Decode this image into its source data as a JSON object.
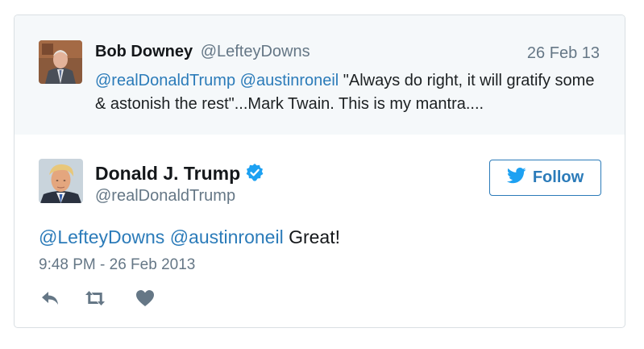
{
  "parent_tweet": {
    "author_name": "Bob Downey",
    "author_handle": "@LefteyDowns",
    "date": "26 Feb 13",
    "mention_1": "@realDonaldTrump",
    "mention_2": "@austinroneil",
    "body": "\"Always do right, it will gratify some & astonish the rest\"...Mark Twain. This is my mantra...."
  },
  "main_tweet": {
    "author_name": "Donald J. Trump",
    "author_handle": "@realDonaldTrump",
    "verified": true,
    "follow_label": "Follow",
    "mention_1": "@LefteyDowns",
    "mention_2": "@austinroneil",
    "body": "Great!",
    "timestamp": "9:48 PM - 26 Feb 2013"
  },
  "actions": [
    {
      "icon": "reply-icon"
    },
    {
      "icon": "retweet-icon"
    },
    {
      "icon": "like-icon"
    }
  ],
  "colors": {
    "link": "#2b7bb9",
    "secondary_text": "#657786",
    "primary_text": "#14171a",
    "parent_background": "#f5f8fa",
    "verified_badge": "#1da1f2",
    "border": "#d9dfe3"
  }
}
